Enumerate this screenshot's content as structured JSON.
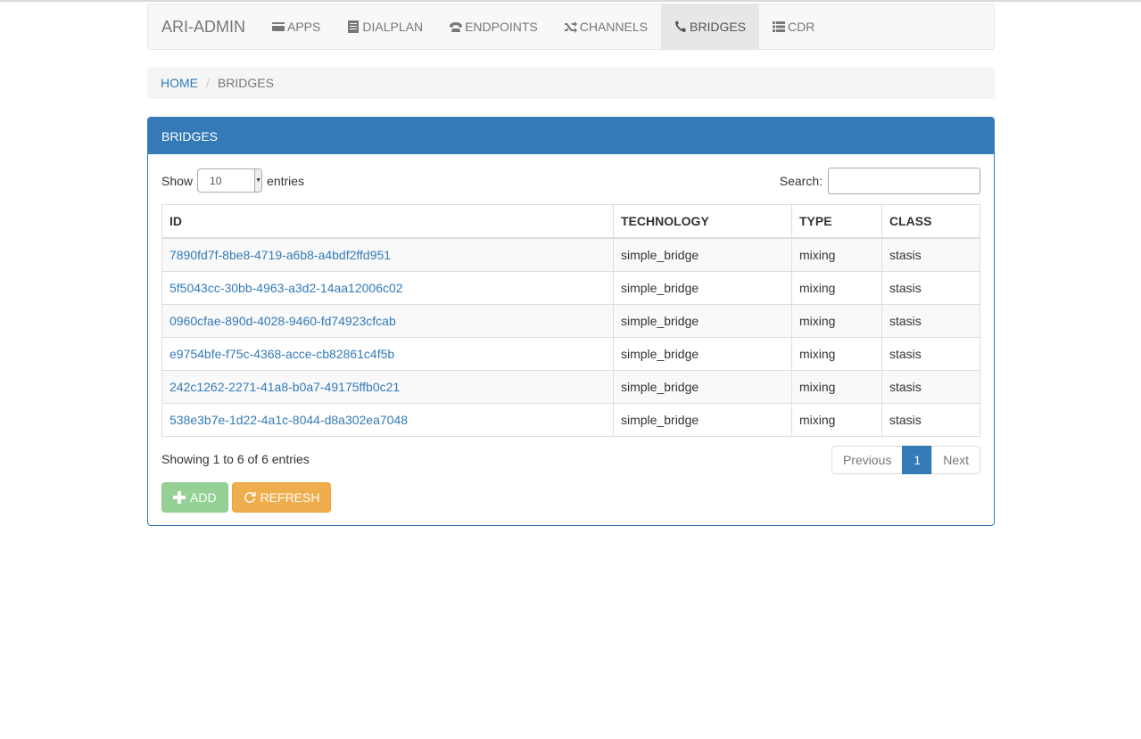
{
  "navbar": {
    "brand": "ARI-ADMIN",
    "items": [
      {
        "label": "APPS",
        "icon": "credit-card-icon"
      },
      {
        "label": "DIALPLAN",
        "icon": "list-alt-icon"
      },
      {
        "label": "ENDPOINTS",
        "icon": "phone-alt-icon"
      },
      {
        "label": "CHANNELS",
        "icon": "random-icon"
      },
      {
        "label": "BRIDGES",
        "icon": "earphone-icon",
        "active": true
      },
      {
        "label": "CDR",
        "icon": "list-icon"
      }
    ]
  },
  "breadcrumb": {
    "home": "HOME",
    "separator": "/",
    "current": "BRIDGES"
  },
  "panel": {
    "title": "BRIDGES",
    "length": {
      "prefix": "Show",
      "value": "10",
      "suffix": "entries"
    },
    "search": {
      "label": "Search:",
      "value": ""
    },
    "table": {
      "headers": [
        "ID",
        "TECHNOLOGY",
        "TYPE",
        "CLASS"
      ],
      "rows": [
        {
          "id": "7890fd7f-8be8-4719-a6b8-a4bdf2ffd951",
          "technology": "simple_bridge",
          "type": "mixing",
          "class": "stasis"
        },
        {
          "id": "5f5043cc-30bb-4963-a3d2-14aa12006c02",
          "technology": "simple_bridge",
          "type": "mixing",
          "class": "stasis"
        },
        {
          "id": "0960cfae-890d-4028-9460-fd74923cfcab",
          "technology": "simple_bridge",
          "type": "mixing",
          "class": "stasis"
        },
        {
          "id": "e9754bfe-f75c-4368-acce-cb82861c4f5b",
          "technology": "simple_bridge",
          "type": "mixing",
          "class": "stasis"
        },
        {
          "id": "242c1262-2271-41a8-b0a7-49175ffb0c21",
          "technology": "simple_bridge",
          "type": "mixing",
          "class": "stasis"
        },
        {
          "id": "538e3b7e-1d22-4a1c-8044-d8a302ea7048",
          "technology": "simple_bridge",
          "type": "mixing",
          "class": "stasis"
        }
      ]
    },
    "info": "Showing 1 to 6 of 6 entries",
    "pagination": {
      "previous": "Previous",
      "current": "1",
      "next": "Next"
    },
    "buttons": {
      "add": "ADD",
      "refresh": "REFRESH"
    }
  },
  "colors": {
    "primary": "#337ab7",
    "success": "#5cb85c",
    "warning": "#f0ad4e"
  }
}
